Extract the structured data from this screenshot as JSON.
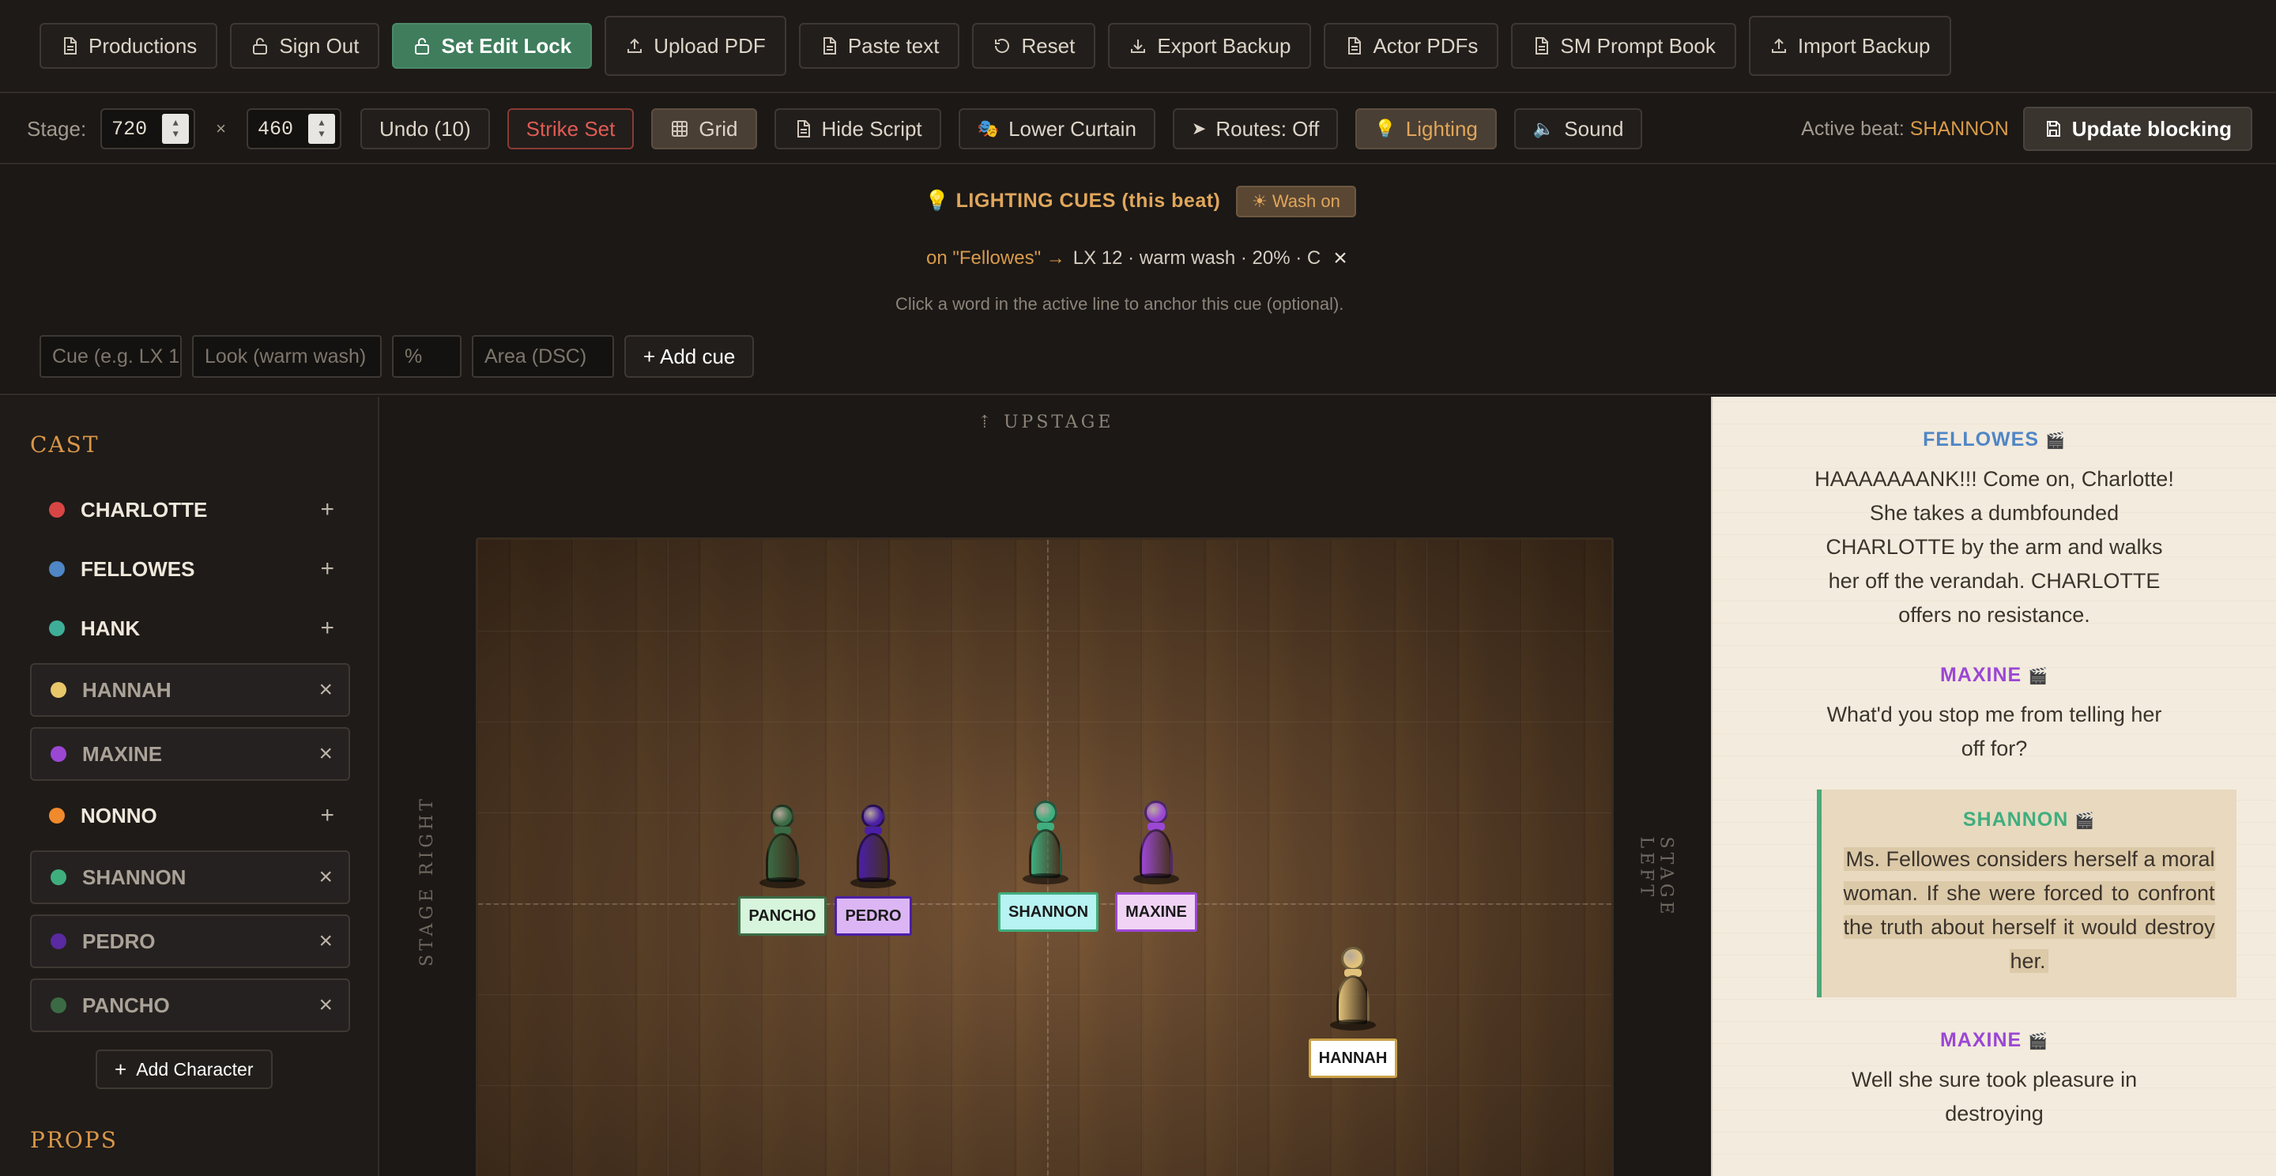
{
  "toolbar": {
    "productions": "Productions",
    "sign_out": "Sign Out",
    "set_edit_lock": "Set Edit Lock",
    "upload_pdf": "Upload PDF",
    "paste_text": "Paste text",
    "reset": "Reset",
    "export_backup": "Export Backup",
    "actor_pdfs": "Actor PDFs",
    "sm_prompt_book": "SM Prompt Book",
    "import_backup": "Import Backup"
  },
  "stagebar": {
    "stage_label": "Stage:",
    "width": "720",
    "times": "×",
    "height": "460",
    "undo": "Undo (10)",
    "strike_set": "Strike Set",
    "grid": "Grid",
    "hide_script": "Hide Script",
    "lower_curtain": "Lower Curtain",
    "routes": "Routes: Off",
    "lighting": "Lighting",
    "sound": "Sound",
    "active_beat_label": "Active beat:",
    "active_beat_value": "SHANNON",
    "update_blocking": "Update blocking"
  },
  "cues": {
    "title": "LIGHTING CUES (this beat)",
    "wash_button": "☀ Wash on",
    "cue_anchor": "on \"Fellowes\" →",
    "cue_text": "LX 12 · warm wash · 20% · C",
    "hint": "Click a word in the active line to anchor this cue (optional).",
    "cue_placeholder": "Cue (e.g. LX 1",
    "look_placeholder": "Look (warm wash)",
    "percent_placeholder": "%",
    "area_placeholder": "Area (DSC)",
    "add_cue": "+ Add cue"
  },
  "sidebar": {
    "cast_heading": "CAST",
    "cast": [
      {
        "name": "CHARLOTTE",
        "color": "#d84545",
        "action": "+"
      },
      {
        "name": "FELLOWES",
        "color": "#4f86c6",
        "action": "+"
      },
      {
        "name": "HANK",
        "color": "#3fae98",
        "action": "+"
      },
      {
        "name": "HANNAH",
        "color": "#e8c66a",
        "action": "×"
      },
      {
        "name": "MAXINE",
        "color": "#9b47d4",
        "action": "×"
      },
      {
        "name": "NONNO",
        "color": "#f08a2c",
        "action": "+"
      },
      {
        "name": "SHANNON",
        "color": "#3fae7e",
        "action": "×"
      },
      {
        "name": "PEDRO",
        "color": "#5a2aa0",
        "action": "×"
      },
      {
        "name": "PANCHO",
        "color": "#3b6b44",
        "action": "×"
      }
    ],
    "add_character": "Add Character",
    "props_heading": "PROPS"
  },
  "stage": {
    "upstage": "⇡ UPSTAGE",
    "stage_right": "STAGE RIGHT",
    "stage_left": "STAGE LEFT",
    "actors": [
      {
        "name": "PANCHO",
        "color": "#3b6b44",
        "tag_bg": "#d7f5dc",
        "tag_border": "#3b6b44"
      },
      {
        "name": "PEDRO",
        "color": "#4b1fa6",
        "tag_bg": "#dcb6f4",
        "tag_border": "#4b1fa6"
      },
      {
        "name": "SHANNON",
        "color": "#3fae7e",
        "tag_bg": "#b7f3f2",
        "tag_border": "#3fae7e"
      },
      {
        "name": "MAXINE",
        "color": "#9b47d4",
        "tag_bg": "#f1d4f5",
        "tag_border": "#9b47d4"
      },
      {
        "name": "HANNAH",
        "color": "#e2c27a",
        "tag_bg": "#ffffff",
        "tag_border": "#c9a24a"
      }
    ]
  },
  "script": {
    "lines": [
      {
        "speaker": "FELLOWES",
        "icon": "🎬",
        "color": "#4f86c6",
        "text": "HAAAAAAANK!!! Come on, Charlotte! She takes a dumbfounded CHARLOTTE by the arm and walks her off the verandah. CHARLOTTE offers no resistance."
      },
      {
        "speaker": "MAXINE",
        "icon": "🎬",
        "color": "#9b47d4",
        "text": "What'd you stop me from telling her off for?"
      },
      {
        "speaker": "SHANNON",
        "icon": "🎬",
        "color": "#3fae7e",
        "text": "Ms. Fellowes considers herself a moral woman. If she were forced to confront the truth about herself it would destroy her."
      },
      {
        "speaker": "MAXINE",
        "icon": "🎬",
        "color": "#9b47d4",
        "text": "Well she sure took pleasure in destroying"
      }
    ]
  }
}
